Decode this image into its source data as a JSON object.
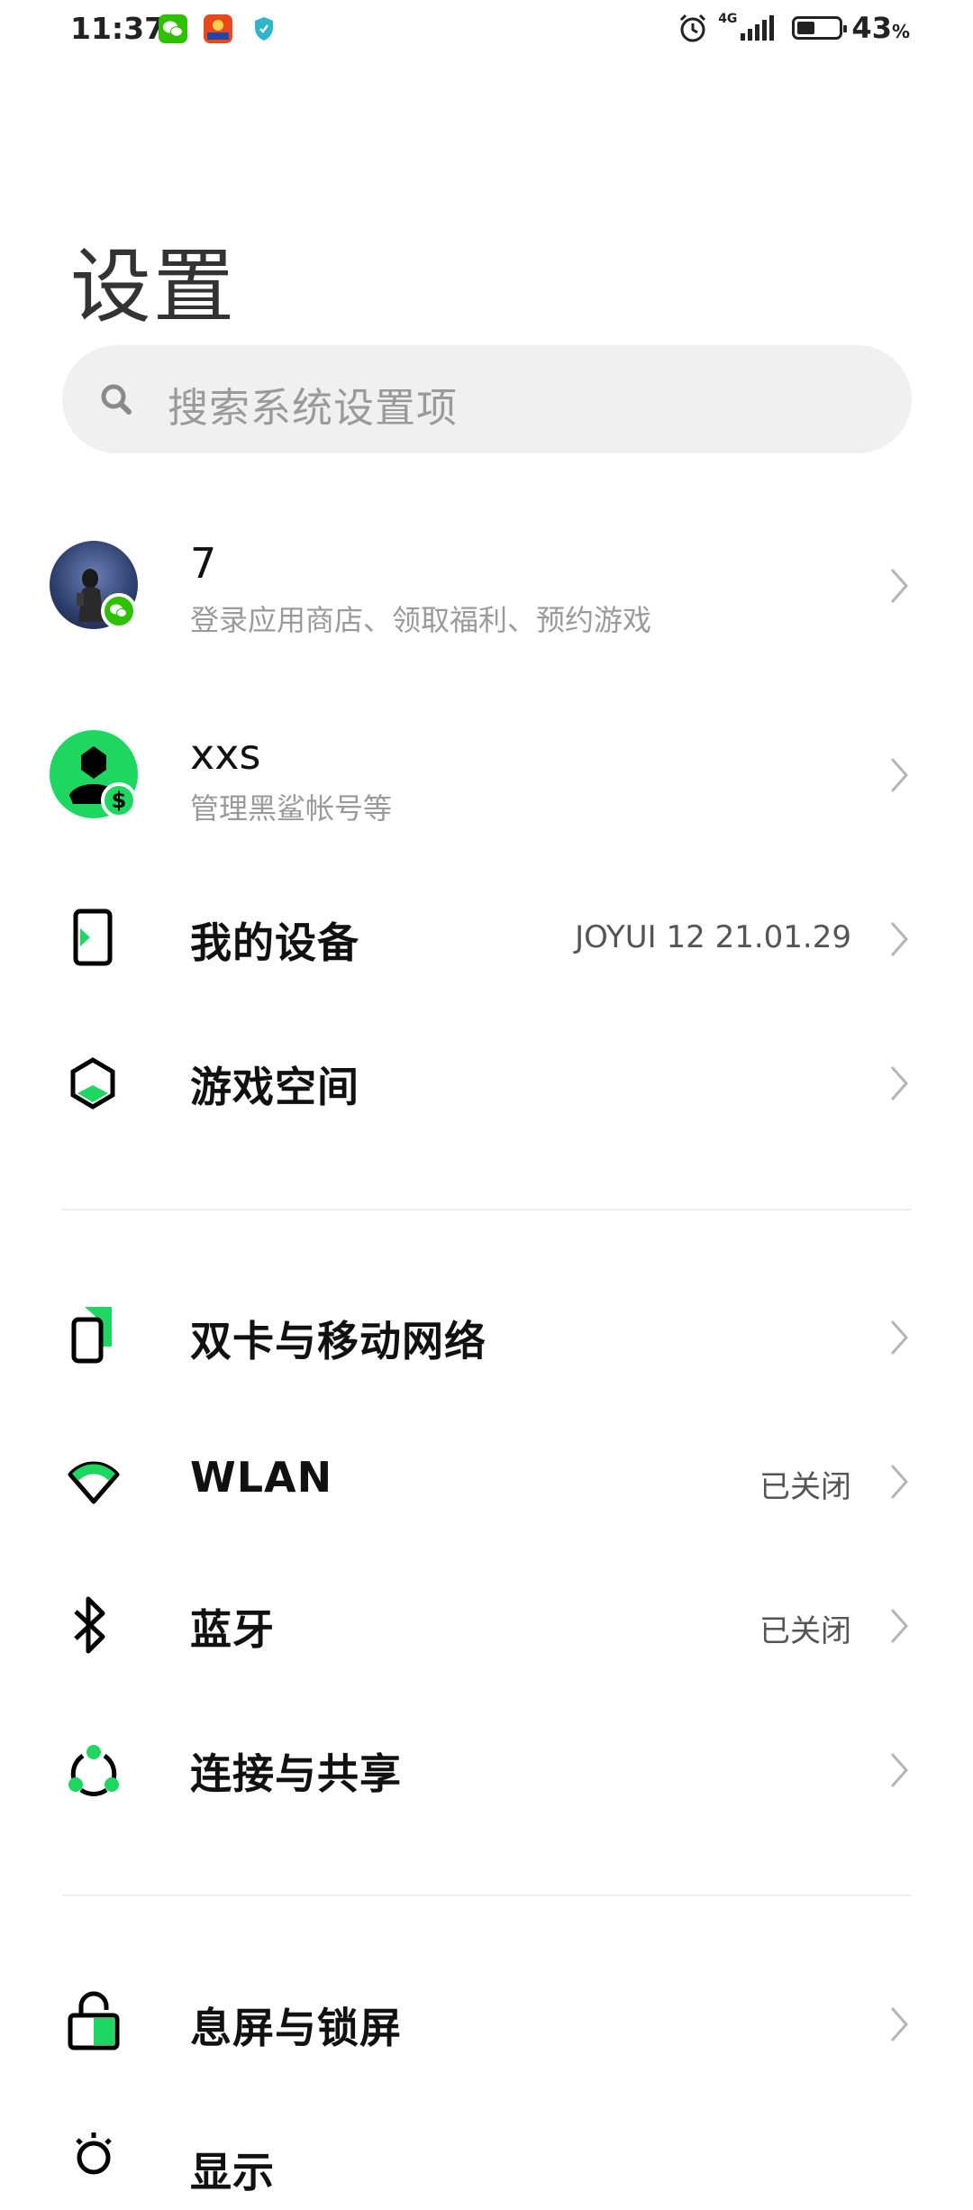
{
  "status_bar": {
    "time": "11:37",
    "network": "4G",
    "battery_percent": "43",
    "battery_unit": "%",
    "battery_level": 0.43
  },
  "page": {
    "title": "设置"
  },
  "search": {
    "placeholder": "搜索系统设置项"
  },
  "accounts": [
    {
      "name": "7",
      "subtitle": "登录应用商店、领取福利、预约游戏"
    },
    {
      "name": "xxs",
      "subtitle": "管理黑鲨帐号等"
    }
  ],
  "group1": [
    {
      "label": "我的设备",
      "value": "JOYUI 12 21.01.29",
      "icon": "phone-icon"
    },
    {
      "label": "游戏空间",
      "value": "",
      "icon": "hexagon-icon"
    }
  ],
  "group2": [
    {
      "label": "双卡与移动网络",
      "value": "",
      "icon": "sim-card-icon"
    },
    {
      "label": "WLAN",
      "value": "已关闭",
      "icon": "wifi-icon"
    },
    {
      "label": "蓝牙",
      "value": "已关闭",
      "icon": "bluetooth-icon"
    },
    {
      "label": "连接与共享",
      "value": "",
      "icon": "share-icon"
    }
  ],
  "group3": [
    {
      "label": "息屏与锁屏",
      "value": "",
      "icon": "lock-icon"
    },
    {
      "label": "显示",
      "value": "",
      "icon": "brightness-icon"
    }
  ],
  "colors": {
    "accent": "#1ed760",
    "text": "#111111",
    "secondary": "#9a9a9a"
  }
}
